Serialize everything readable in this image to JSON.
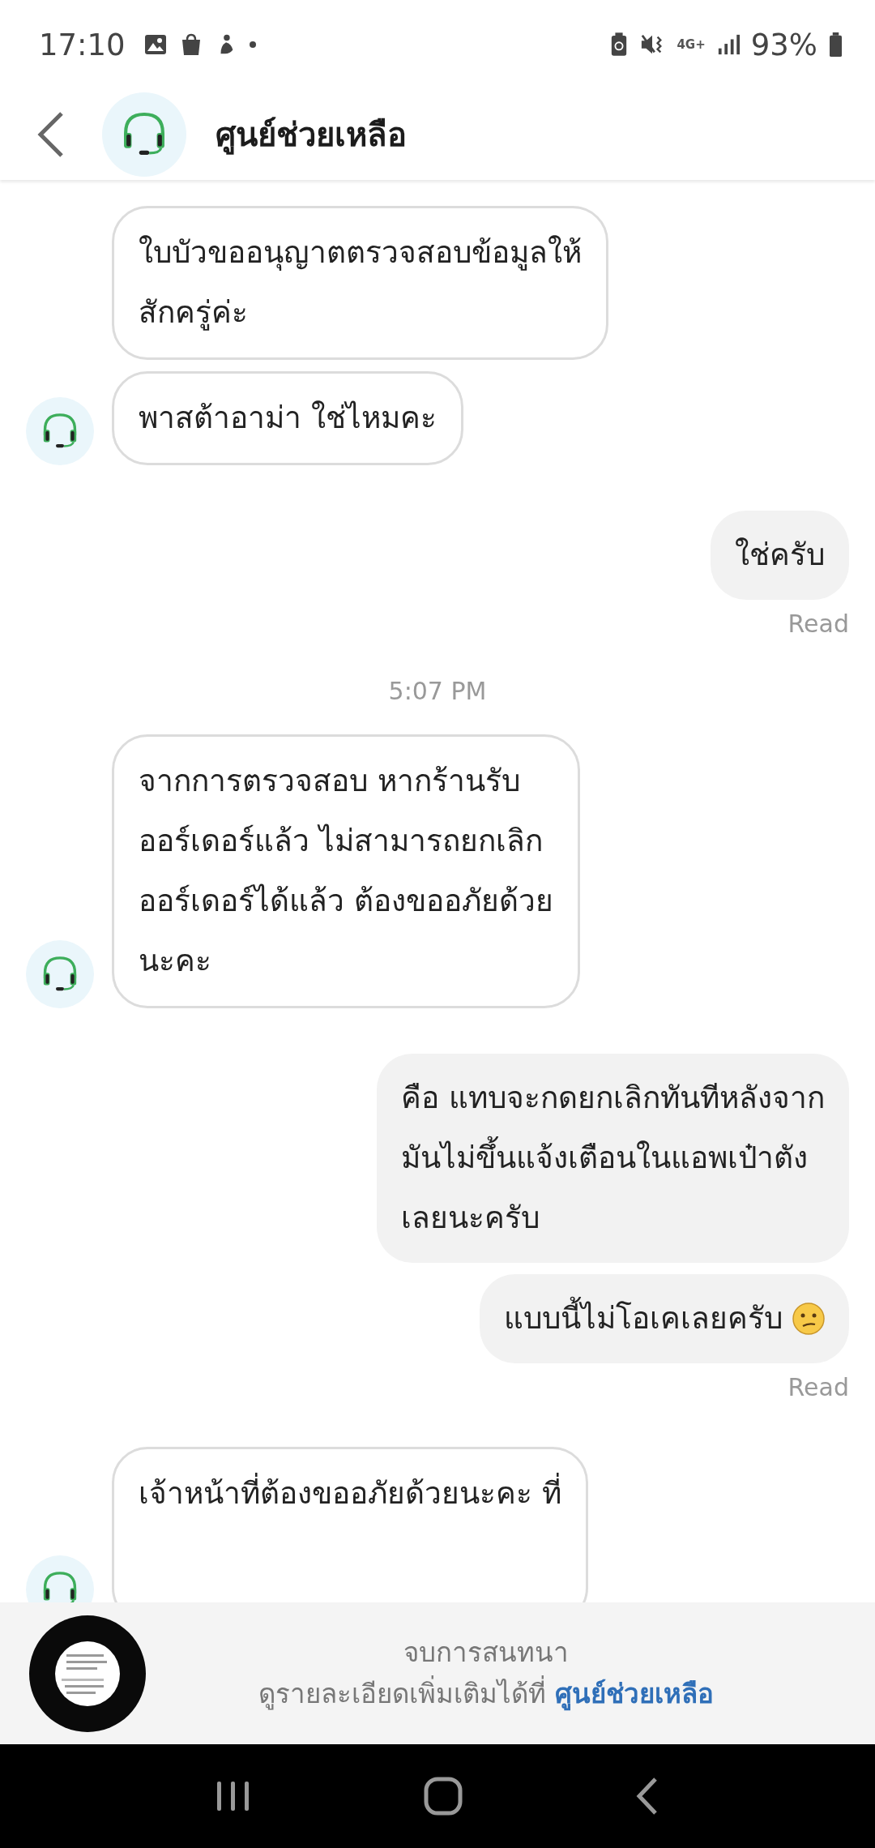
{
  "status_bar": {
    "time": "17:10",
    "network": "4G+",
    "battery": "93%"
  },
  "header": {
    "title": "ศูนย์ช่วยเหลือ"
  },
  "messages": [
    {
      "kind": "agent",
      "text": "ใบบัวขออนุญาตตรวจสอบข้อมูลให้\nสักครู่ค่ะ",
      "avatar": false
    },
    {
      "kind": "agent",
      "text": "พาสต้าอาม่า ใช่ไหมคะ",
      "avatar": true
    },
    {
      "kind": "user",
      "text": "ใช่ครับ",
      "emoji": false
    },
    {
      "kind": "read",
      "text": "Read"
    },
    {
      "kind": "time",
      "text": "5:07 PM"
    },
    {
      "kind": "agent",
      "text": "จากการตรวจสอบ หากร้านรับ\nออร์เดอร์แล้ว ไม่สามารถยกเลิก\nออร์เดอร์ได้แล้ว ต้องขออภัยด้วย\nนะคะ",
      "avatar": true
    },
    {
      "kind": "user",
      "text": "คือ แทบจะกดยกเลิกทันทีหลังจาก\nมันไม่ขึ้นแจ้งเตือนในแอพเป๋าตัง\nเลยนะครับ",
      "emoji": false
    },
    {
      "kind": "user",
      "text": "แบบนี้ไม่โอเคเลยครับ",
      "emoji": true
    },
    {
      "kind": "read",
      "text": "Read"
    },
    {
      "kind": "agent",
      "text": "เจ้าหน้าที่ต้องขออภัยด้วยนะคะ ที่",
      "avatar": true
    }
  ],
  "footer": {
    "status": "จบการสนทนา",
    "note": "ดูรายละเอียดเพิ่มเติมได้ที่",
    "link": "ศูนย์ช่วยเหลือ"
  }
}
